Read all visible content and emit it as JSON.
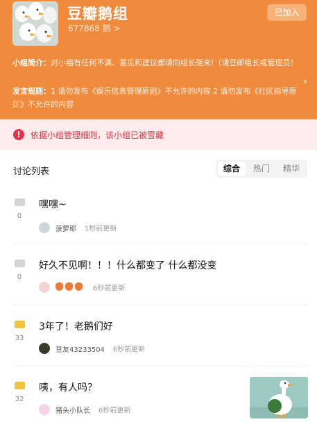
{
  "group": {
    "name": "豆瓣鹅组",
    "members": "677868 鹅 >",
    "joined_label": "已加入",
    "intro_label": "小组简介：",
    "intro_text": "对小组有任何不满、意见和建议都请向组长砸来!（请豆邮组长或管理员！有紧要事务务必发送邮件至 bagualaile@foxm...",
    "rules_label": "发言规则：",
    "rules_text": "1 请勿发布《娱乐信息管理原则》不允许的内容 2 请勿发布《社区指导原则》不允许的内容"
  },
  "alert": {
    "icon": "!",
    "text": "依据小组管理细则，该小组已被雪藏"
  },
  "discussion": {
    "title": "讨论列表",
    "tabs": [
      {
        "label": "综合"
      },
      {
        "label": "热门"
      },
      {
        "label": "精华"
      }
    ]
  },
  "posts": [
    {
      "title": "嘿嘿~",
      "count": "0",
      "author": "菠萝耶",
      "time": "1秒前更新"
    },
    {
      "title": "好久不见啊！！！什么都变了 什么都没变",
      "count": "0",
      "author": "",
      "time": "6秒前更新"
    },
    {
      "title": "3年了！老鹅们好",
      "count": "33",
      "author": "豆友43233504",
      "time": "6秒前更新"
    },
    {
      "title": "咦，有人吗？",
      "count": "32",
      "author": "猪头小队长",
      "time": "6秒前更新"
    }
  ],
  "colors": {
    "header_bg": "#f08a3c",
    "alert_bg": "#fcecee",
    "alert_red": "#e0334a",
    "comment_grey": "#d5d5d5",
    "comment_yellow": "#f2c43b"
  }
}
